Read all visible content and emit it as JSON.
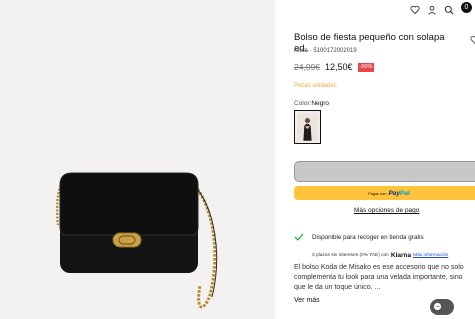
{
  "header": {
    "icons": [
      "heart-icon",
      "user-icon",
      "search-icon",
      "bag-icon"
    ],
    "bag_count": "0"
  },
  "product": {
    "title": "Bolso de fiesta pequeño con solapa ed.",
    "reference": "Koda - 5100172002019",
    "old_price": "24,99€",
    "new_price": "12,50€",
    "discount": "-50%",
    "stock": "Pocas unidades",
    "color_label": "Color:",
    "color_value": "Negro",
    "paypal_small": "Pagar con",
    "paypal_pay": "Pay",
    "paypal_pal": "Pal",
    "more_options": "Más opciones de pago",
    "pickup": "Disponible para recoger en tienda gratis",
    "klarna_text": "3 plazos sin intereses (0% TAE) con",
    "klarna_logo": "Klarna",
    "klarna_link": "Más información",
    "description": "El bolso Koda de Misako es ese accesorio que no solo complementa tu look para una velada importante, sino que le da un toque único. ...",
    "see_more": "Ver más"
  },
  "colors": {
    "discount_bg": "#e5484d",
    "stock": "#f0a63a",
    "paypal_bg": "#ffc439",
    "check": "#22b14c",
    "klarna_link": "#1f4fd1"
  }
}
